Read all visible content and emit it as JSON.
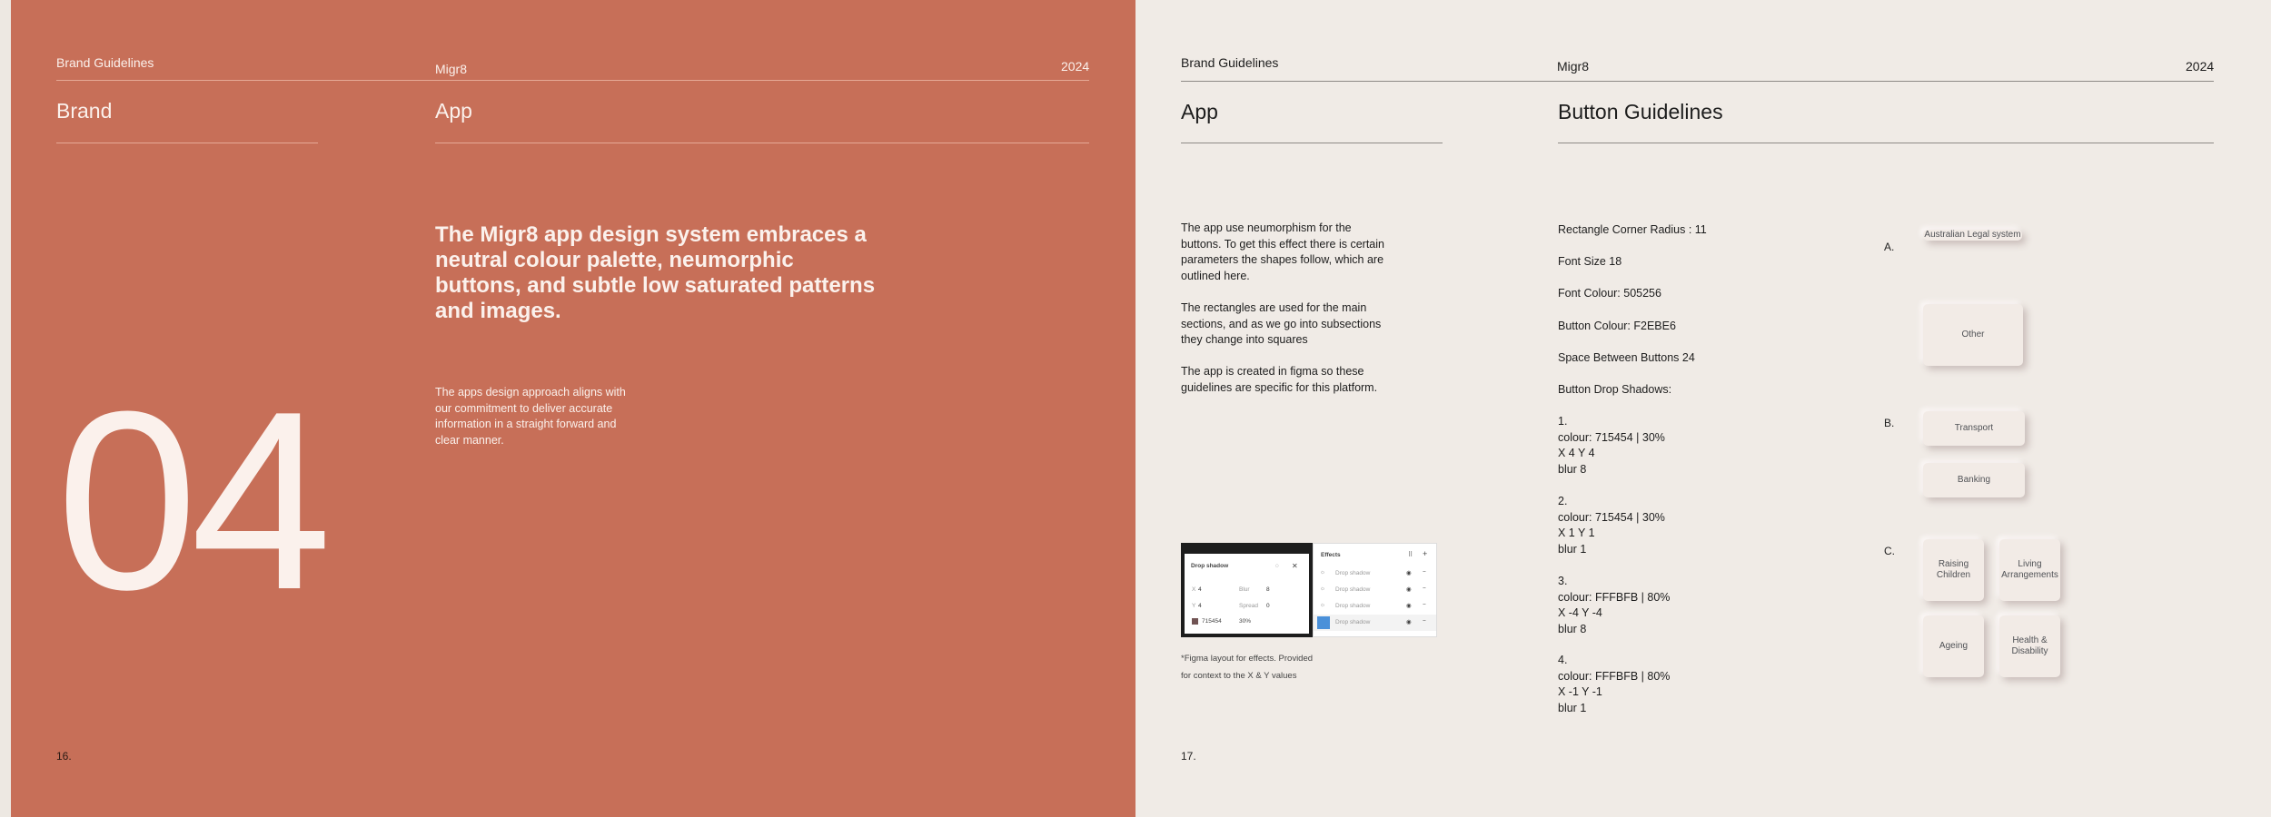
{
  "left_page": {
    "header_left": "Brand Guidelines",
    "header_center": "Migr8",
    "header_right": "2024",
    "section_left": "Brand",
    "section_right": "App",
    "chapter_number": "04",
    "headline": "The Migr8 app design system embraces a  neutral colour palette, neumorphic buttons, and subtle low saturated patterns and images.",
    "body": "The apps design approach aligns with our commitment to deliver accurate information in a straight forward and clear manner.",
    "page_number": "16."
  },
  "right_page": {
    "header_left": "Brand Guidelines",
    "header_center": "Migr8",
    "header_right": "2024",
    "section_left": "App",
    "section_right": "Button Guidelines",
    "paragraphs": [
      "The app use neumorphism for the buttons. To get this effect there is certain parameters the shapes follow, which are outlined here.",
      "The rectangles are used for the main sections, and as we go into subsections they change into squares",
      "The app is created in figma so these guidelines are specific for this platform."
    ],
    "specs": [
      "Rectangle Corner Radius : 11",
      "Font Size 18",
      "Font Colour: 505256",
      "Button Colour: F2EBE6",
      "Space Between Buttons 24",
      "Button Drop Shadows:"
    ],
    "shadows": [
      [
        "1.",
        "colour: 715454 | 30%",
        "X 4 Y 4",
        "blur 8"
      ],
      [
        "2.",
        "colour: 715454 | 30%",
        "X 1 Y 1",
        "blur 1"
      ],
      [
        "3.",
        "colour: FFFBFB | 80%",
        "X -4 Y -4",
        "blur 8"
      ],
      [
        "4.",
        "colour: FFFBFB | 80%",
        "X -1 Y -1",
        "blur 1"
      ]
    ],
    "figma_caption_1": "*Figma layout for effects. Provided",
    "figma_caption_2": "for context to the X & Y values",
    "page_number": "17.",
    "groups": {
      "a": {
        "letter": "A.",
        "buttons": [
          "Australian Legal system",
          "Other"
        ]
      },
      "b": {
        "letter": "B.",
        "buttons": [
          "Transport",
          "Banking"
        ]
      },
      "c": {
        "letter": "C.",
        "buttons": [
          "Raising Children",
          "Living Arrangements",
          "Ageing",
          "Health & Disability"
        ]
      }
    }
  },
  "figma_panel": {
    "drop_shadow_title": "Drop shadow",
    "x_value": "4",
    "y_value": "4",
    "blur_label": "Blur",
    "blur_value": "8",
    "spread_label": "Spread",
    "spread_value": "0",
    "color_hex": "715454",
    "color_opacity": "30%",
    "effects_title": "Effects",
    "effect_item": "Drop shadow",
    "colors": {
      "swatch": "#715454",
      "selected": "#4a90d9"
    }
  },
  "colors": {
    "left_page_bg": "#c76f58",
    "right_page_bg": "#f0ebe6",
    "button_bg": "#F2EBE6",
    "button_text": "#505256"
  }
}
